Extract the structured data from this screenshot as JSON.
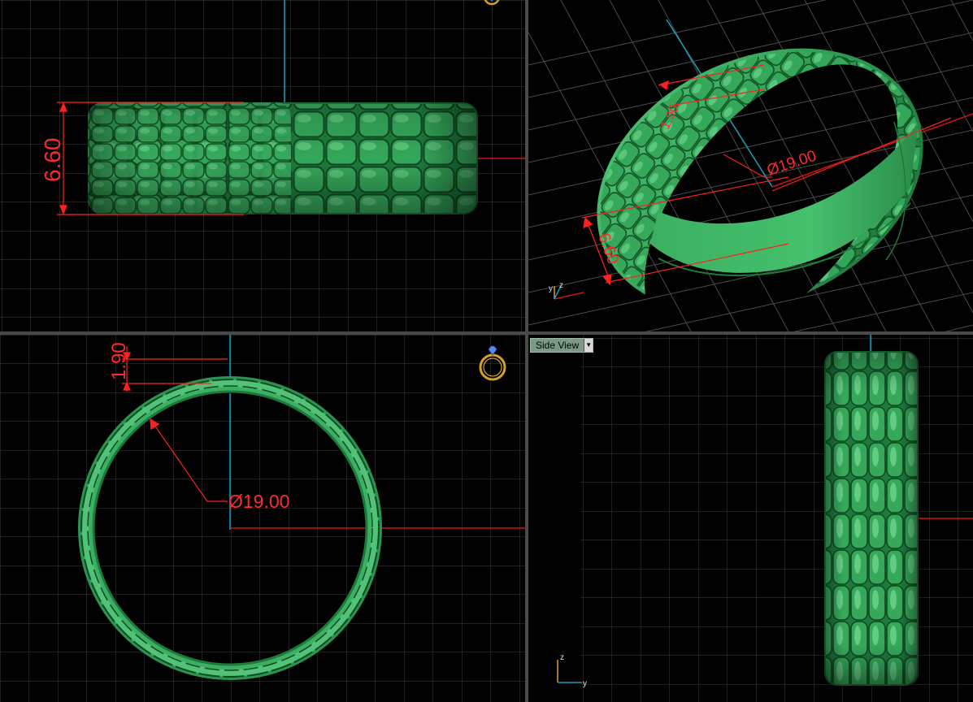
{
  "viewports": {
    "front": {
      "height_dim": "6.60"
    },
    "perspective": {
      "width_dim": "1.90",
      "diameter_dim": "Ø19.00",
      "height_dim": "6.60",
      "axis_y": "y",
      "axis_z": "z"
    },
    "top": {
      "thickness_dim": "1.90",
      "diameter_dim": "Ø19.00",
      "ring_icon": "ring-icon"
    },
    "side": {
      "label": "Side View",
      "dropdown_icon": "chevron-down-icon",
      "axis_y": "y",
      "axis_z": "z"
    }
  },
  "colors": {
    "background": "#000000",
    "grid": "#3c3c3c",
    "grid_major": "#5a5a5a",
    "ring": "#2ea055",
    "ring_light": "#7be09a",
    "ring_dark": "#135c2b",
    "dimension": "#ff2020",
    "axis_red": "#cc1414",
    "axis_cyan": "#1aa0c0",
    "viewport_border": "#4a4a4a"
  }
}
